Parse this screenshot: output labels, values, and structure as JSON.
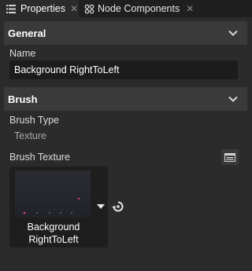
{
  "tabs": [
    {
      "label": "Properties",
      "icon": "properties-list-icon"
    },
    {
      "label": "Node Components",
      "icon": "node-components-icon"
    }
  ],
  "sections": {
    "general": {
      "title": "General"
    },
    "brush": {
      "title": "Brush"
    }
  },
  "name_field": {
    "label": "Name",
    "value": "Background RightToLeft"
  },
  "brush_type": {
    "label": "Brush Type",
    "value": "Texture"
  },
  "brush_texture": {
    "label": "Brush Texture",
    "thumbnail_caption_line1": "Background",
    "thumbnail_caption_line2": "RightToLeft"
  },
  "colors": {
    "background": "#2b2b2b",
    "header": "#3a3a3a",
    "field": "#1c1c1c",
    "accent_dot": "#d04060"
  }
}
